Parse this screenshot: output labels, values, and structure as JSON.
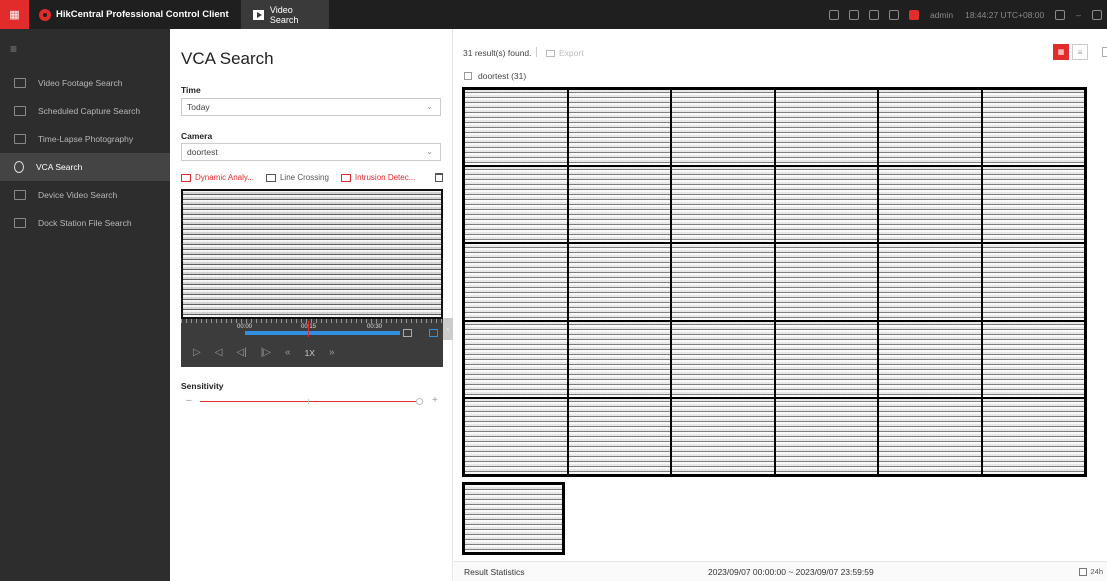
{
  "topbar": {
    "app_title": "HikCentral Professional Control Client",
    "tab_label": "Video Search",
    "user": "admin",
    "clock": "18:44:27 UTC+08:00"
  },
  "nav": {
    "items": [
      {
        "label": "Video Footage Search"
      },
      {
        "label": "Scheduled Capture Search"
      },
      {
        "label": "Time-Lapse Photography"
      },
      {
        "label": "VCA Search"
      },
      {
        "label": "Device Video Search"
      },
      {
        "label": "Dock Station File Search"
      }
    ]
  },
  "panel": {
    "title": "VCA Search",
    "time_label": "Time",
    "time_value": "Today",
    "camera_label": "Camera",
    "camera_value": "doortest",
    "rules": [
      "Dynamic Analy...",
      "Line Crossing",
      "Intrusion Detec..."
    ],
    "timeline_labels": [
      "00:00",
      "00:15",
      "00:30"
    ],
    "speed": "1X",
    "sensitivity_label": "Sensitivity",
    "sensitivity_level": 1.0
  },
  "results": {
    "count_text": "31 result(s) found.",
    "export_label": "Export",
    "camera_filter": "doortest (31)",
    "thumbnail_count": 31,
    "status_label": "Result Statistics",
    "range_text": "2023/09/07 00:00:00 ~ 2023/09/07 23:59:59",
    "duration_label": "24h"
  },
  "colors": {
    "accent": "#e22b2b",
    "nav_bg": "#2d2d2d",
    "topbar_bg": "#1f1f1f"
  }
}
